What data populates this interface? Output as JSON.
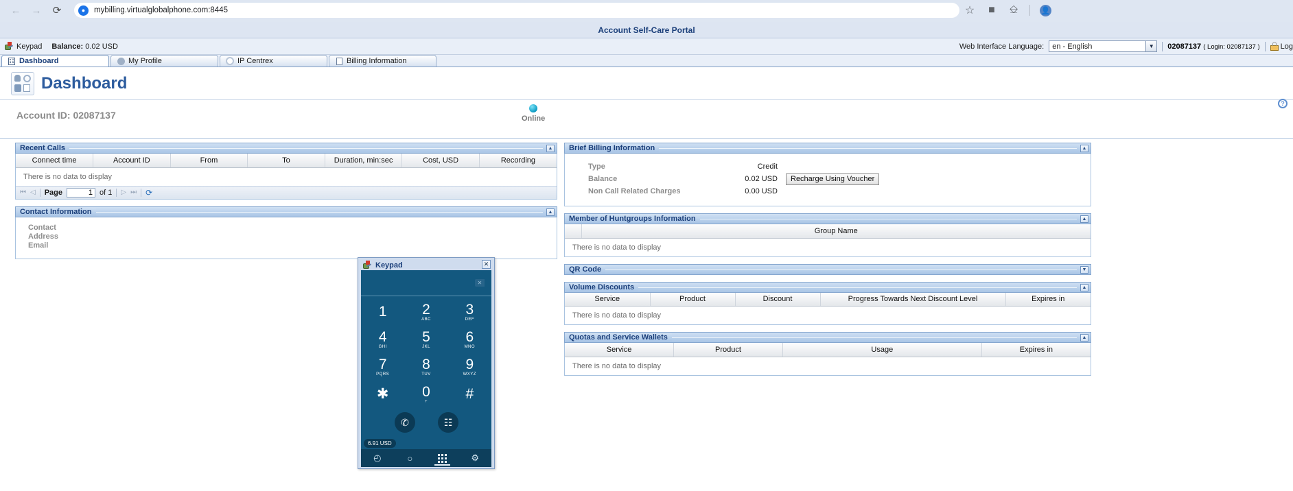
{
  "browser": {
    "back_icon": "back-arrow-icon",
    "forward_icon": "forward-arrow-icon",
    "reload_icon": "reload-icon",
    "url": "mybilling.virtualglobalphone.com:8445",
    "mic_glyph": "⬤",
    "star_icon": "bookmark-star-icon",
    "extensions_icon": "extensions-icon",
    "split_icon": "split-screen-icon",
    "profile_icon": "profile-avatar-icon"
  },
  "portal": {
    "title": "Account Self-Care Portal",
    "keypad_link": "Keypad",
    "balance_label": "Balance:",
    "balance_value": "0.02 USD",
    "language_label": "Web Interface Language:",
    "language_value": "en - English",
    "account_number": "02087137",
    "login_text": "( Login: 02087137 )",
    "logout_label": "Log"
  },
  "tabs": [
    {
      "label": "Dashboard",
      "icon": "dashboard-icon",
      "active": true
    },
    {
      "label": "My Profile",
      "icon": "person-icon",
      "active": false
    },
    {
      "label": "IP Centrex",
      "icon": "gear-icon",
      "active": false
    },
    {
      "label": "Billing Information",
      "icon": "document-icon",
      "active": false
    }
  ],
  "page": {
    "title": "Dashboard",
    "help_icon": "help-icon",
    "account_id_label": "Account ID: 02087137",
    "status_label": "Online"
  },
  "recent_calls": {
    "title": "Recent Calls",
    "columns": [
      "Connect time",
      "Account ID",
      "From",
      "To",
      "Duration, min:sec",
      "Cost, USD",
      "Recording"
    ],
    "empty_text": "There is no data to display",
    "pager": {
      "first_icon": "first-page-icon",
      "prev_icon": "prev-page-icon",
      "page_label": "Page",
      "page_value": "1",
      "of_text": "of 1",
      "next_icon": "next-page-icon",
      "last_icon": "last-page-icon",
      "refresh_icon": "refresh-icon"
    }
  },
  "contact_information": {
    "title": "Contact Information",
    "rows": [
      "Contact",
      "Address",
      "Email"
    ]
  },
  "brief_billing": {
    "title": "Brief Billing Information",
    "rows": [
      {
        "label": "Type",
        "value": "Credit"
      },
      {
        "label": "Balance",
        "value": "0.02 USD"
      },
      {
        "label": "Non Call Related Charges",
        "value": "0.00 USD"
      }
    ],
    "voucher_button": "Recharge Using Voucher"
  },
  "huntgroups": {
    "title": "Member of Huntgroups Information",
    "columns": [
      "",
      "Group Name"
    ],
    "empty_text": "There is no data to display"
  },
  "qr_code": {
    "title": "QR Code"
  },
  "volume_discounts": {
    "title": "Volume Discounts",
    "columns": [
      "Service",
      "Product",
      "Discount",
      "Progress Towards Next Discount Level",
      "Expires in"
    ],
    "empty_text": "There is no data to display"
  },
  "quotas": {
    "title": "Quotas and Service Wallets",
    "columns": [
      "Service",
      "Product",
      "Usage",
      "Expires in"
    ],
    "empty_text": "There is no data to display"
  },
  "keypad": {
    "title": "Keypad",
    "close_label": "✕",
    "display_value": "",
    "backspace_icon": "backspace-icon",
    "keys": [
      {
        "digit": "1",
        "letters": ""
      },
      {
        "digit": "2",
        "letters": "ABC"
      },
      {
        "digit": "3",
        "letters": "DEF"
      },
      {
        "digit": "4",
        "letters": "GHI"
      },
      {
        "digit": "5",
        "letters": "JKL"
      },
      {
        "digit": "6",
        "letters": "MNO"
      },
      {
        "digit": "7",
        "letters": "PQRS"
      },
      {
        "digit": "8",
        "letters": "TUV"
      },
      {
        "digit": "9",
        "letters": "WXYZ"
      },
      {
        "digit": "✱",
        "letters": ""
      },
      {
        "digit": "0",
        "letters": "+"
      },
      {
        "digit": "#",
        "letters": ""
      }
    ],
    "call_icon": "✆",
    "message_icon": "☷",
    "balance_badge": "6.91 USD",
    "nav": [
      {
        "icon": "recents-clock-icon",
        "glyph": "◴",
        "active": false
      },
      {
        "icon": "messages-bubble-icon",
        "glyph": "○",
        "active": false
      },
      {
        "icon": "keypad-dots-icon",
        "glyph": "",
        "active": true
      },
      {
        "icon": "settings-gear-icon",
        "glyph": "⚙",
        "active": false
      }
    ]
  },
  "colors": {
    "accent_blue": "#1b3f7a",
    "panel_header": "#a9c5e6",
    "keypad_bg": "#13587f",
    "keypad_dark": "#0b3a55",
    "title_blue": "#2d5c9e"
  }
}
